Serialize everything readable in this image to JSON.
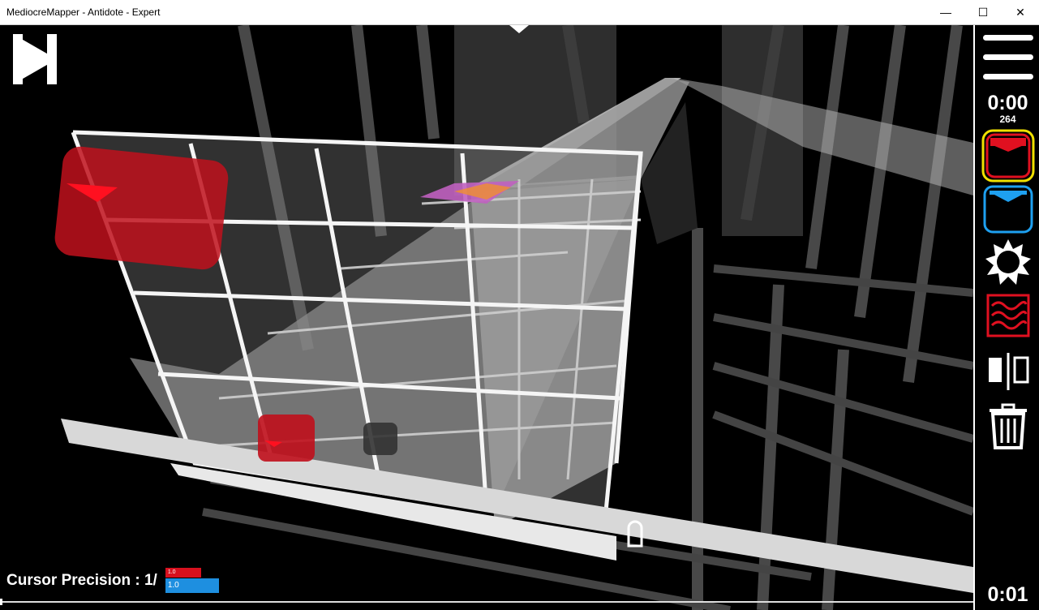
{
  "window": {
    "title": "MediocreMapper - Antidote - Expert",
    "minimize_glyph": "—",
    "maximize_glyph": "☐",
    "close_glyph": "✕"
  },
  "toolbar": {
    "play_icon": "play-icon",
    "pause_icon": "pause-icon"
  },
  "sidebar": {
    "menu_icon": "hamburger-menu-icon",
    "time_current": "0:00",
    "bpm": "264",
    "items": [
      {
        "name": "red-note-tool",
        "color": "#e01020",
        "selected": true,
        "selected_color": "#f0e000"
      },
      {
        "name": "blue-note-tool",
        "color": "#1ea0f0",
        "selected": false
      },
      {
        "name": "bomb-tool"
      },
      {
        "name": "wall-tool",
        "color": "#e01020"
      },
      {
        "name": "mirror-tool"
      },
      {
        "name": "delete-tool"
      }
    ],
    "time_bottom": "0:01"
  },
  "status": {
    "cursor_precision_label": "Cursor Precision : 1/",
    "red_value": "1.0",
    "blue_value": "1.0"
  },
  "colors": {
    "background": "#000000",
    "accent_red": "#d7101e",
    "accent_blue": "#1e8fe0",
    "grid_white": "#f0f0f0"
  }
}
